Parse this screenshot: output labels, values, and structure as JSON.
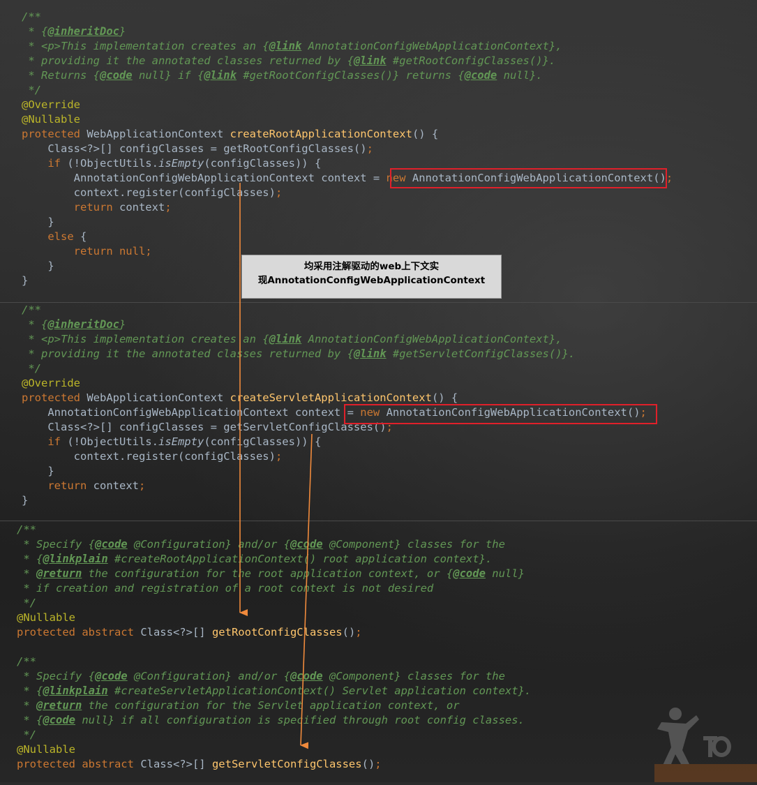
{
  "block1": {
    "lines": [
      "/**",
      " * {@inheritDoc}",
      " * <p>This implementation creates an {@link AnnotationConfigWebApplicationContext},",
      " * providing it the annotated classes returned by {@link #getRootConfigClasses()}.",
      " * Returns {@code null} if {@link #getRootConfigClasses()} returns {@code null}.",
      " */",
      "@Override",
      "@Nullable",
      "protected WebApplicationContext createRootApplicationContext() {",
      "    Class<?>[] configClasses = getRootConfigClasses();",
      "    if (!ObjectUtils.isEmpty(configClasses)) {",
      "        AnnotationConfigWebApplicationContext context = new AnnotationConfigWebApplicationContext();",
      "        context.register(configClasses);",
      "        return context;",
      "    }",
      "    else {",
      "        return null;",
      "    }",
      "}"
    ]
  },
  "block2": {
    "lines": [
      "/**",
      " * {@inheritDoc}",
      " * <p>This implementation creates an {@link AnnotationConfigWebApplicationContext},",
      " * providing it the annotated classes returned by {@link #getServletConfigClasses()}.",
      " */",
      "@Override",
      "protected WebApplicationContext createServletApplicationContext() {",
      "    AnnotationConfigWebApplicationContext context = new AnnotationConfigWebApplicationContext();",
      "    Class<?>[] configClasses = getServletConfigClasses();",
      "    if (!ObjectUtils.isEmpty(configClasses)) {",
      "        context.register(configClasses);",
      "    }",
      "    return context;",
      "}"
    ]
  },
  "block3": {
    "lines": [
      "/**",
      " * Specify {@code @Configuration} and/or {@code @Component} classes for the",
      " * {@linkplain #createRootApplicationContext() root application context}.",
      " * @return the configuration for the root application context, or {@code null}",
      " * if creation and registration of a root context is not desired",
      " */",
      "@Nullable",
      "protected abstract Class<?>[] getRootConfigClasses();",
      "",
      "/**",
      " * Specify {@code @Configuration} and/or {@code @Component} classes for the",
      " * {@linkplain #createServletApplicationContext() Servlet application context}.",
      " * @return the configuration for the Servlet application context, or",
      " * {@code null} if all configuration is specified through root config classes.",
      " */",
      "@Nullable",
      "protected abstract Class<?>[] getServletConfigClasses();"
    ]
  },
  "tooltip": {
    "line1": "均采用注解驱动的web上下文实",
    "line2": "现AnnotationConfigWebApplicationContext"
  },
  "colors": {
    "comment": "#629755",
    "keyword": "#cc7832",
    "annotation": "#bbb529",
    "method": "#ffc66d",
    "text": "#a9b7c6",
    "highlight_box": "#e0202a",
    "arrow": "#f08a3c"
  },
  "icons": {
    "logo": "karate-figure-logo"
  }
}
